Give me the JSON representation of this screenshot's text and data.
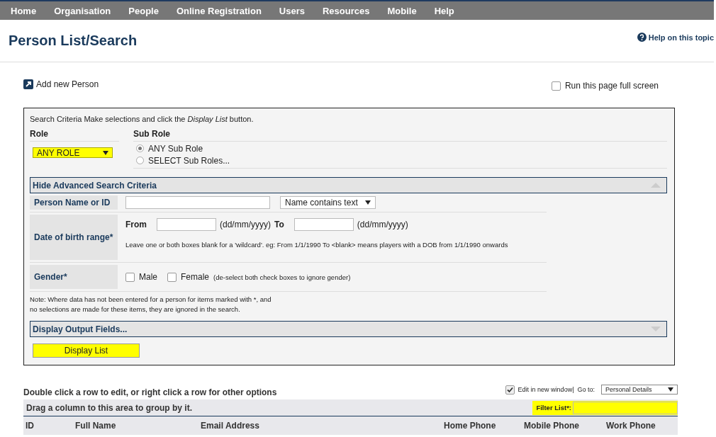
{
  "nav": {
    "items": [
      {
        "label": "Home"
      },
      {
        "label": "Organisation"
      },
      {
        "label": "People"
      },
      {
        "label": "Online Registration"
      },
      {
        "label": "Users"
      },
      {
        "label": "Resources"
      },
      {
        "label": "Mobile"
      },
      {
        "label": "Help"
      }
    ]
  },
  "page": {
    "title": "Person List/Search",
    "help_link": "Help on this topic",
    "add_person": "Add new Person",
    "full_screen": {
      "label": "Run this page full screen",
      "checked": false
    }
  },
  "search": {
    "intro": "Search Criteria Make selections and click the *Display List* button.",
    "role": {
      "label": "Role",
      "value": "ANY ROLE"
    },
    "sub_role": {
      "label": "Sub Role",
      "options": [
        {
          "label": "ANY Sub Role",
          "selected": true
        },
        {
          "label": "SELECT Sub Roles...",
          "selected": false
        }
      ]
    },
    "advanced_header": {
      "label": "Hide Advanced Search Criteria",
      "expanded": true
    },
    "person_name": {
      "label": "Person Name or ID",
      "match": "Name contains text"
    },
    "dob": {
      "label": "Date of birth range*",
      "from_label": "From",
      "from_hint": "(dd/mm/yyyy)",
      "to_label": "To",
      "to_hint": "(dd/mm/yyyy)",
      "note": "Leave one or both boxes blank for a 'wildcard'. eg: From 1/1/1990 To <blank> means players with a DOB from 1/1/1990 onwards"
    },
    "gender": {
      "label": "Gender*",
      "options": [
        {
          "label": "Male",
          "checked": false
        },
        {
          "label": "Female",
          "checked": false
        }
      ],
      "hint": "(de-select both check boxes to ignore gender)"
    },
    "note": [
      "Note: Where data has not been entered for a person for items marked with *, and",
      "no selections are made for these items, they are ignored in the search."
    ],
    "output_header": {
      "label": "Display Output Fields...",
      "expanded": false
    },
    "display_button": "Display List"
  },
  "grid": {
    "instruction": "Double click a row to edit, or right click a row for other options",
    "edit_new_window": {
      "label": "Edit in new window|",
      "checked": true
    },
    "goto_label": "Go to:",
    "goto_value": "Personal Details",
    "group_area": "Drag a column to this area to group by it.",
    "filter_label": "Filter List*:",
    "columns": [
      "ID",
      "Full Name",
      "Email Address",
      "Home Phone",
      "Mobile Phone",
      "Work Phone"
    ]
  }
}
